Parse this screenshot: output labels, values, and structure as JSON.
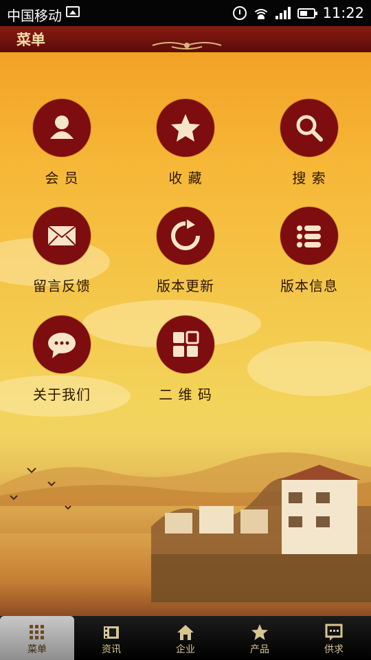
{
  "status_bar": {
    "carrier": "中国移动",
    "time": "11:22"
  },
  "header": {
    "title": "菜单"
  },
  "menu": [
    {
      "id": "member",
      "label": "会 员",
      "icon": "user-icon"
    },
    {
      "id": "favorites",
      "label": "收 藏",
      "icon": "star-icon"
    },
    {
      "id": "search",
      "label": "搜 索",
      "icon": "search-icon"
    },
    {
      "id": "feedback",
      "label": "留言反馈",
      "icon": "envelope-icon"
    },
    {
      "id": "update",
      "label": "版本更新",
      "icon": "refresh-icon"
    },
    {
      "id": "version",
      "label": "版本信息",
      "icon": "list-icon"
    },
    {
      "id": "about",
      "label": "关于我们",
      "icon": "chat-icon"
    },
    {
      "id": "qrcode",
      "label": "二 维 码",
      "icon": "qrcode-icon"
    }
  ],
  "bottom_nav": [
    {
      "label": "菜单",
      "icon": "grid-icon",
      "active": true
    },
    {
      "label": "资讯",
      "icon": "film-icon",
      "active": false
    },
    {
      "label": "企业",
      "icon": "home-icon",
      "active": false
    },
    {
      "label": "产品",
      "icon": "star-icon",
      "active": false
    },
    {
      "label": "供求",
      "icon": "message-icon",
      "active": false
    }
  ],
  "colors": {
    "accent": "#7d0d0f",
    "header": "#6e120d",
    "header_text": "#f4dca8",
    "nav_text": "#d8c690"
  }
}
